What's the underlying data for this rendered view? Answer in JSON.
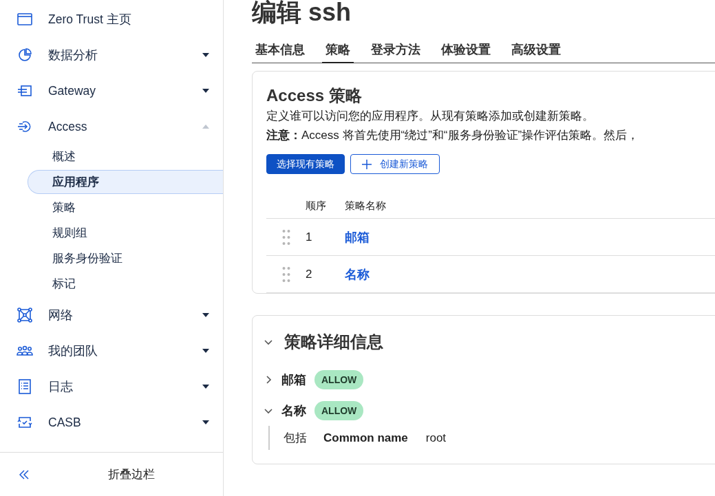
{
  "sidebar": {
    "items": [
      {
        "label": "Zero Trust 主页"
      },
      {
        "label": "数据分析",
        "expanded": false
      },
      {
        "label": "Gateway",
        "expanded": false
      },
      {
        "label": "Access",
        "expanded": true,
        "children": [
          {
            "label": "概述",
            "selected": false
          },
          {
            "label": "应用程序",
            "selected": true
          },
          {
            "label": "策略",
            "selected": false
          },
          {
            "label": "规则组",
            "selected": false
          },
          {
            "label": "服务身份验证",
            "selected": false
          },
          {
            "label": "标记",
            "selected": false
          }
        ]
      },
      {
        "label": "网络",
        "expanded": false
      },
      {
        "label": "我的团队",
        "expanded": false
      },
      {
        "label": "日志",
        "expanded": false
      },
      {
        "label": "CASB",
        "expanded": false
      }
    ],
    "collapse_label": "折叠边栏"
  },
  "page_title": "编辑 ssh",
  "tabs": [
    {
      "label": "基本信息",
      "selected": false
    },
    {
      "label": "策略",
      "selected": true
    },
    {
      "label": "登录方法",
      "selected": false
    },
    {
      "label": "体验设置",
      "selected": false
    },
    {
      "label": "高级设置",
      "selected": false
    }
  ],
  "access_card": {
    "title": "Access 策略",
    "description": "定义谁可以访问您的应用程序。从现有策略添加或创建新策略。",
    "notice": "**注意：**Access 将首先使用“绕过”和“服务身份验证”操作评估策略。然后，",
    "buttons": [
      {
        "label": "选择现有策略",
        "kind": "primary"
      },
      {
        "label": "创建新策略",
        "kind": "add"
      }
    ],
    "table": {
      "columns": [
        "顺序",
        "策略名称"
      ],
      "rows": [
        {
          "order": "1",
          "name": "邮箱"
        },
        {
          "order": "2",
          "name": "名称"
        }
      ]
    }
  },
  "details_card": {
    "title": "策略详细信息",
    "expanded": true,
    "policies": [
      {
        "name": "邮箱",
        "action": "ALLOW",
        "expanded": false
      },
      {
        "name": "名称",
        "action": "ALLOW",
        "expanded": true,
        "rules": [
          {
            "type": "包括",
            "selector": "Common name",
            "value": "root"
          }
        ]
      }
    ]
  }
}
